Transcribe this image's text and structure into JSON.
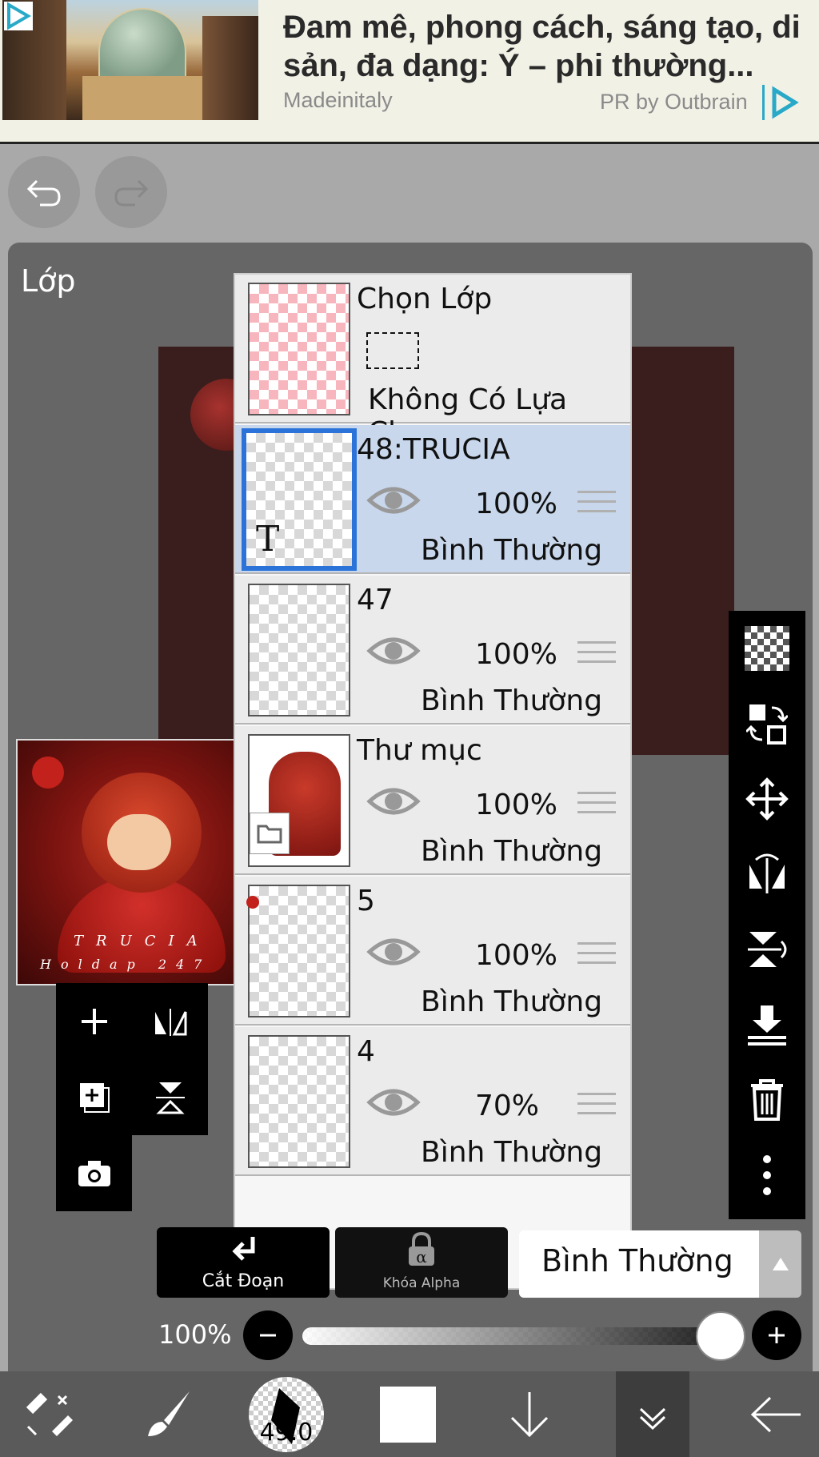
{
  "ad": {
    "title": "Đam mê, phong cách, sáng tạo, di sản, đa dạng: Ý – phi thường...",
    "source": "Madeinitaly",
    "pr_label": "PR by Outbrain"
  },
  "panel": {
    "title": "Lớp"
  },
  "thumbnail": {
    "line1": "TRUCIA",
    "line2": "Holdap 247"
  },
  "layers": [
    {
      "name": "Chọn Lớp",
      "subtitle": "Không Có Lựa Chọn",
      "type": "selection"
    },
    {
      "name": "48:TRUCIA",
      "opacity": "100%",
      "blend": "Bình Thường",
      "selected": true,
      "kind": "text"
    },
    {
      "name": "47",
      "opacity": "100%",
      "blend": "Bình Thường"
    },
    {
      "name": "Thư mục",
      "opacity": "100%",
      "blend": "Bình Thường",
      "kind": "folder"
    },
    {
      "name": "5",
      "opacity": "100%",
      "blend": "Bình Thường"
    },
    {
      "name": "4",
      "opacity": "70%",
      "blend": "Bình Thường"
    }
  ],
  "controls": {
    "clip_label": "Cắt Đoạn",
    "alpha_lock_label": "Khóa Alpha",
    "blend_mode": "Bình Thường",
    "opacity_label": "100%",
    "opacity_value": 1.0
  },
  "bottom_bar": {
    "brush_size": "49.0"
  },
  "colors": {
    "accent": "#2b73d9",
    "selected_row": "#c8d7ec",
    "panel_bg": "#666666"
  }
}
